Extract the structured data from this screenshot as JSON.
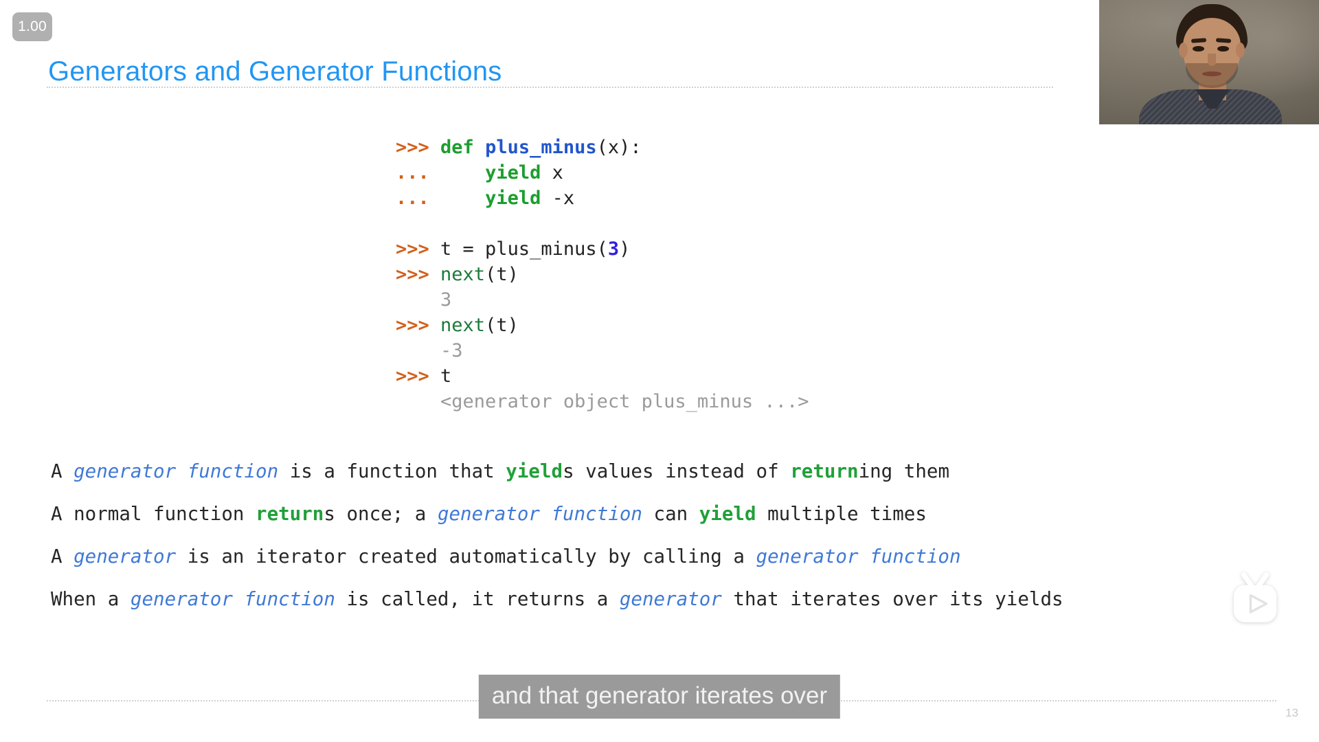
{
  "player": {
    "speed_label": "1.00",
    "watermark_icon": "tv-play-icon"
  },
  "slide": {
    "title": "Generators and Generator Functions",
    "page_number": "13",
    "title_color": "#2196f3"
  },
  "code": {
    "language": "python-repl",
    "lines": [
      {
        "prompt": ">>> ",
        "tokens": [
          {
            "t": "def ",
            "c": "kw"
          },
          {
            "t": "plus_minus",
            "c": "fn"
          },
          {
            "t": "(x):",
            "c": "plain"
          }
        ]
      },
      {
        "prompt": "... ",
        "tokens": [
          {
            "t": "    ",
            "c": "plain"
          },
          {
            "t": "yield",
            "c": "kw"
          },
          {
            "t": " x",
            "c": "plain"
          }
        ]
      },
      {
        "prompt": "... ",
        "tokens": [
          {
            "t": "    ",
            "c": "plain"
          },
          {
            "t": "yield",
            "c": "kw"
          },
          {
            "t": " -x",
            "c": "plain"
          }
        ]
      },
      {
        "prompt": "",
        "tokens": []
      },
      {
        "prompt": ">>> ",
        "tokens": [
          {
            "t": "t = plus_minus(",
            "c": "plain"
          },
          {
            "t": "3",
            "c": "num"
          },
          {
            "t": ")",
            "c": "plain"
          }
        ]
      },
      {
        "prompt": ">>> ",
        "tokens": [
          {
            "t": "next",
            "c": "builtin"
          },
          {
            "t": "(t)",
            "c": "plain"
          }
        ]
      },
      {
        "prompt": "",
        "tokens": [
          {
            "t": "3",
            "c": "out"
          }
        ]
      },
      {
        "prompt": ">>> ",
        "tokens": [
          {
            "t": "next",
            "c": "builtin"
          },
          {
            "t": "(t)",
            "c": "plain"
          }
        ]
      },
      {
        "prompt": "",
        "tokens": [
          {
            "t": "-3",
            "c": "out"
          }
        ]
      },
      {
        "prompt": ">>> ",
        "tokens": [
          {
            "t": "t",
            "c": "plain"
          }
        ]
      },
      {
        "prompt": "",
        "tokens": [
          {
            "t": "<generator object plus_minus ...>",
            "c": "out"
          }
        ]
      }
    ]
  },
  "bullets": [
    {
      "segments": [
        {
          "t": "A ",
          "c": "plain"
        },
        {
          "t": "generator function",
          "c": "gen"
        },
        {
          "t": " is a function that ",
          "c": "plain"
        },
        {
          "t": "yield",
          "c": "kw"
        },
        {
          "t": "s values instead of ",
          "c": "plain"
        },
        {
          "t": "return",
          "c": "kw"
        },
        {
          "t": "ing them",
          "c": "plain"
        }
      ]
    },
    {
      "segments": [
        {
          "t": "A normal function ",
          "c": "plain"
        },
        {
          "t": "return",
          "c": "kw"
        },
        {
          "t": "s once; a ",
          "c": "plain"
        },
        {
          "t": "generator function",
          "c": "gen"
        },
        {
          "t": " can ",
          "c": "plain"
        },
        {
          "t": "yield",
          "c": "kw"
        },
        {
          "t": " multiple times",
          "c": "plain"
        }
      ]
    },
    {
      "segments": [
        {
          "t": "A ",
          "c": "plain"
        },
        {
          "t": "generator",
          "c": "gen"
        },
        {
          "t": " is an iterator created automatically by calling a ",
          "c": "plain"
        },
        {
          "t": "generator function",
          "c": "gen"
        }
      ]
    },
    {
      "segments": [
        {
          "t": "When a ",
          "c": "plain"
        },
        {
          "t": "generator function",
          "c": "gen"
        },
        {
          "t": " is called, it returns a ",
          "c": "plain"
        },
        {
          "t": "generator",
          "c": "gen"
        },
        {
          "t": " that iterates over its yields",
          "c": "plain"
        }
      ]
    }
  ],
  "caption": {
    "text": "and that generator iterates over"
  },
  "colors": {
    "title": "#2196f3",
    "prompt": "#d2601a",
    "keyword": "#1c9e2e",
    "function": "#2255cc",
    "number": "#3322dd",
    "output": "#9a9a9a",
    "emphasis": "#3f79d6",
    "caption_bg": "#9a9a9a"
  }
}
